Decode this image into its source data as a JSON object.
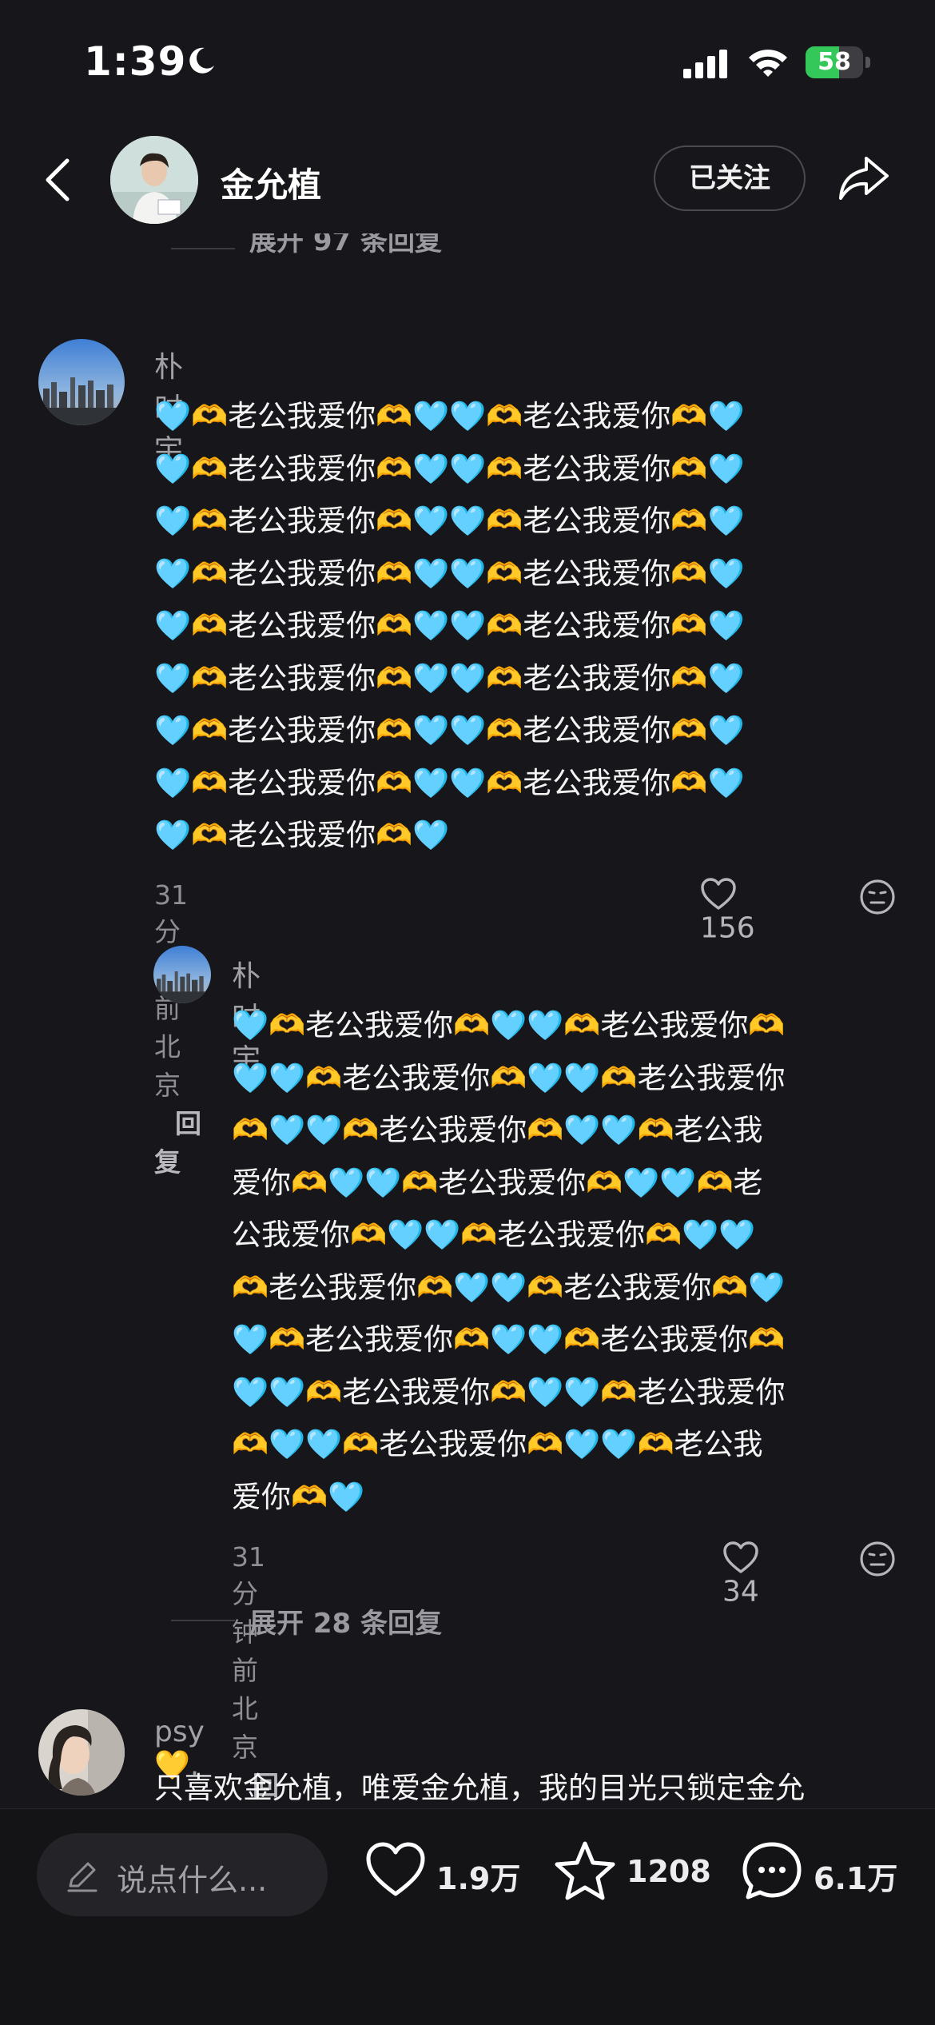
{
  "status_bar": {
    "time": "1:39",
    "battery": "58",
    "battery_level": 0.58
  },
  "header": {
    "name": "金允植",
    "follow_label": "已关注"
  },
  "thread": {
    "expand_top": "展开 97 条回复",
    "expand_mid": "展开 28 条回复"
  },
  "comments": [
    {
      "author": "朴时宇",
      "lines": [
        "🩵🫶老公我爱你🫶🩵🩵🫶老公我爱你🫶🩵",
        "🩵🫶老公我爱你🫶🩵🩵🫶老公我爱你🫶🩵",
        "🩵🫶老公我爱你🫶🩵🩵🫶老公我爱你🫶🩵",
        "🩵🫶老公我爱你🫶🩵🩵🫶老公我爱你🫶🩵",
        "🩵🫶老公我爱你🫶🩵🩵🫶老公我爱你🫶🩵",
        "🩵🫶老公我爱你🫶🩵🩵🫶老公我爱你🫶🩵",
        "🩵🫶老公我爱你🫶🩵🩵🫶老公我爱你🫶🩵",
        "🩵🫶老公我爱你🫶🩵🩵🫶老公我爱你🫶🩵",
        "🩵🫶老公我爱你🫶🩵"
      ],
      "meta": "31分钟前 北京",
      "reply_label": "回复",
      "likes": "156"
    },
    {
      "author": "朴时宇",
      "lines": [
        "🩵🫶老公我爱你🫶🩵🩵🫶老公我爱你🫶",
        "🩵🩵🫶老公我爱你🫶🩵🩵🫶老公我爱你",
        "🫶🩵🩵🫶老公我爱你🫶🩵🩵🫶老公我",
        "爱你🫶🩵🩵🫶老公我爱你🫶🩵🩵🫶老",
        "公我爱你🫶🩵🩵🫶老公我爱你🫶🩵🩵",
        "🫶老公我爱你🫶🩵🩵🫶老公我爱你🫶🩵",
        "🩵🫶老公我爱你🫶🩵🩵🫶老公我爱你🫶",
        "🩵🩵🫶老公我爱你🫶🩵🩵🫶老公我爱你",
        "🫶🩵🩵🫶老公我爱你🫶🩵🩵🫶老公我",
        "爱你🫶🩵"
      ],
      "meta": "31分钟前 北京",
      "reply_label": "回复",
      "likes": "34"
    },
    {
      "author": "psy💛.",
      "lines": [
        "只喜欢金允植，唯爱金允植，我的目光只锁定金允"
      ]
    }
  ],
  "bottom_bar": {
    "placeholder": "说点什么...",
    "likes": "1.9万",
    "favorites": "1208",
    "comments": "6.1万"
  },
  "colors": {
    "background": "#17171b",
    "accent_green": "#34c759",
    "heart_blue": "#5ccff5",
    "hands_yellow": "#f7c531"
  }
}
